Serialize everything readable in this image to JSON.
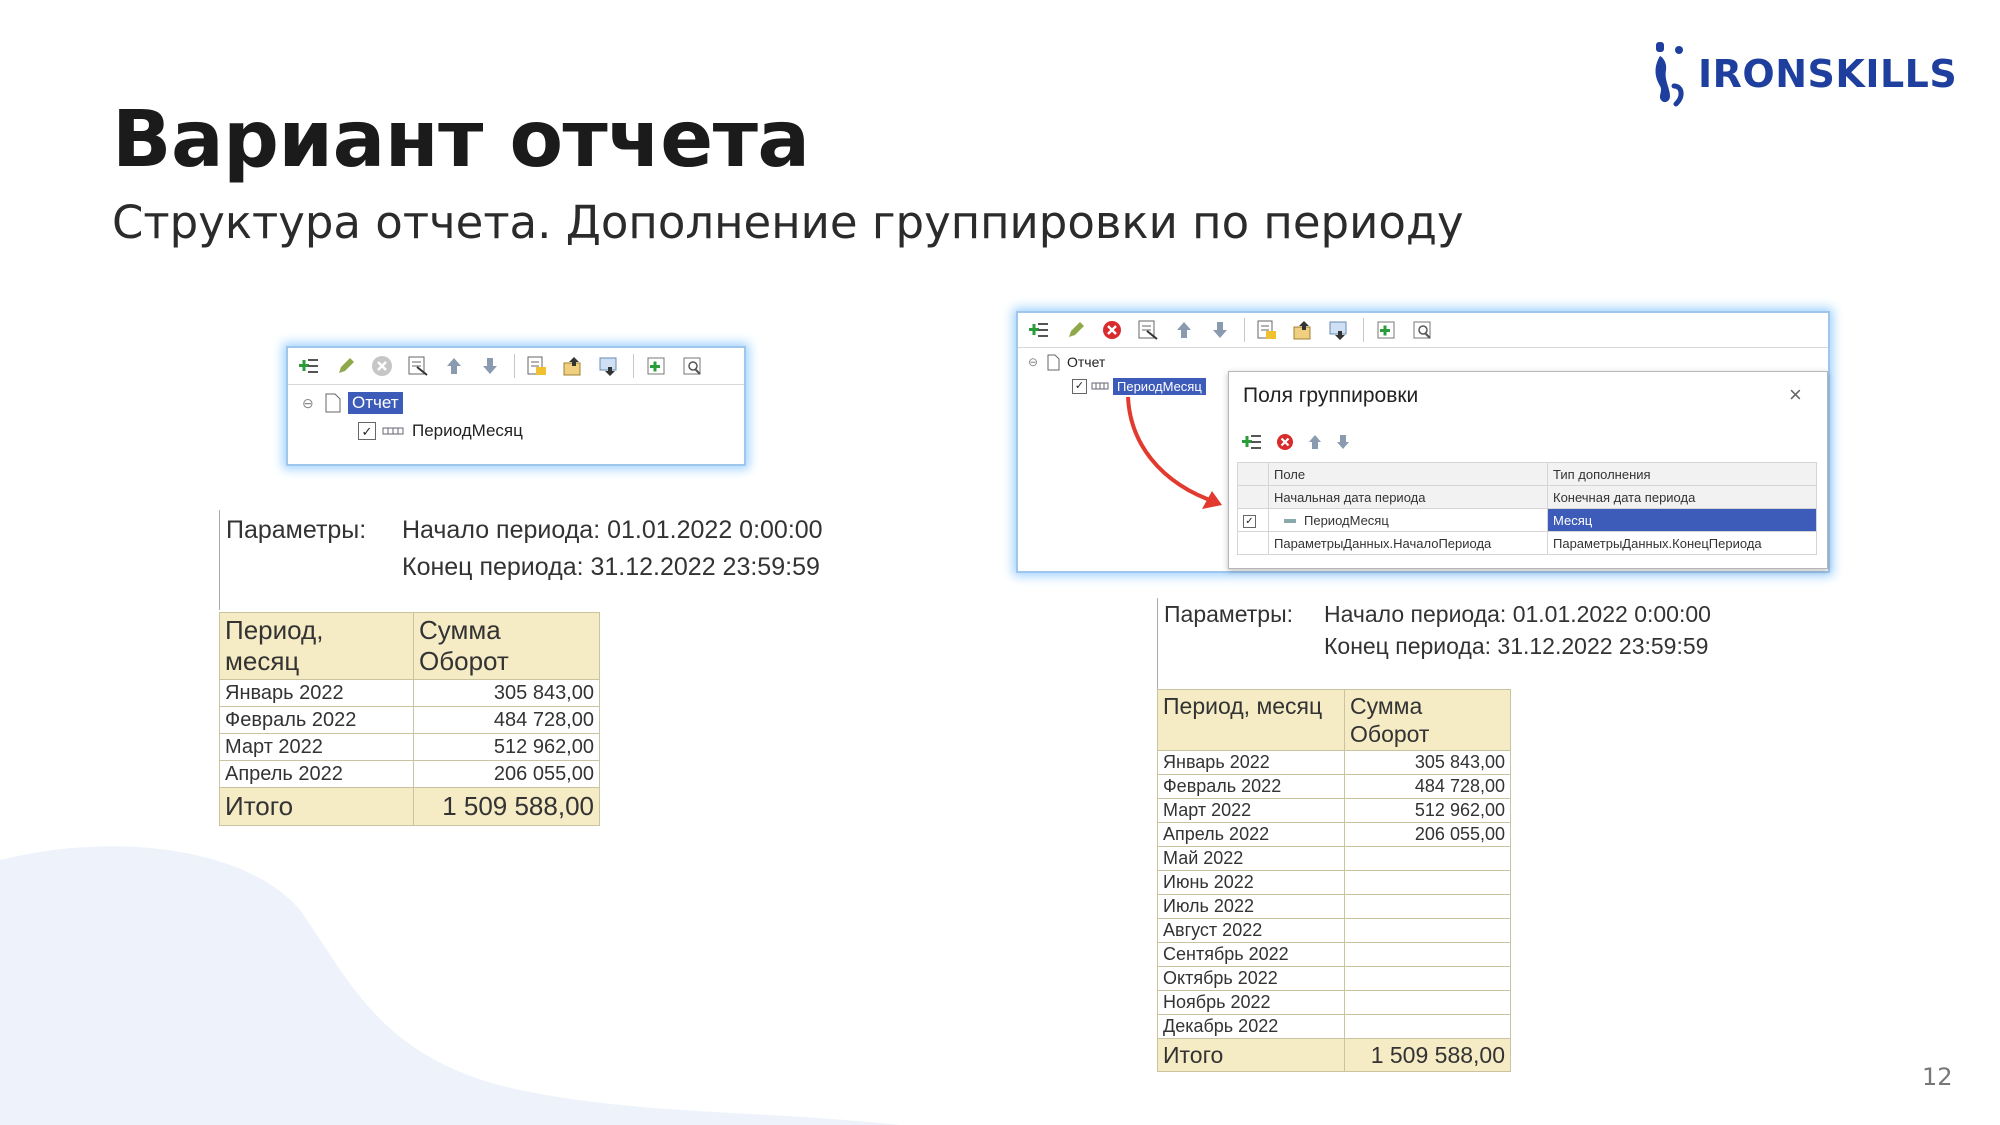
{
  "brand": {
    "logo_text": "IRONSKILLS"
  },
  "slide": {
    "title": "Вариант отчета",
    "subtitle": "Структура отчета. Дополнение группировки по периоду",
    "page_number": "12"
  },
  "left_structure": {
    "root": "Отчет",
    "child": "ПериодМесяц"
  },
  "left_report": {
    "params_label": "Параметры:",
    "param_start": "Начало периода: 01.01.2022 0:00:00",
    "param_end": "Конец периода: 31.12.2022 23:59:59",
    "col_period": [
      "Период,",
      "месяц"
    ],
    "col_sum": [
      "Сумма",
      "Оборот"
    ],
    "rows": [
      {
        "period": "Январь 2022",
        "sum": "305 843,00"
      },
      {
        "period": "Февраль 2022",
        "sum": "484 728,00"
      },
      {
        "period": "Март 2022",
        "sum": "512 962,00"
      },
      {
        "period": "Апрель 2022",
        "sum": "206 055,00"
      }
    ],
    "total_label": "Итого",
    "total_value": "1 509 588,00"
  },
  "right_structure": {
    "root": "Отчет",
    "child": "ПериодМесяц",
    "dialog": {
      "title": "Поля группировки",
      "col_field": "Поле",
      "col_type": "Тип дополнения",
      "rows": [
        {
          "field": "Начальная дата периода",
          "type": "Конечная дата периода"
        },
        {
          "field": "ПериодМесяц",
          "type": "Месяц"
        },
        {
          "field": "ПараметрыДанных.НачалоПериода",
          "type": "ПараметрыДанных.КонецПериода"
        }
      ]
    }
  },
  "right_report": {
    "params_label": "Параметры:",
    "param_start": "Начало периода: 01.01.2022 0:00:00",
    "param_end": "Конец периода: 31.12.2022 23:59:59",
    "col_period": "Период, месяц",
    "col_sum": [
      "Сумма",
      "Оборот"
    ],
    "rows": [
      {
        "period": "Январь 2022",
        "sum": "305 843,00"
      },
      {
        "period": "Февраль 2022",
        "sum": "484 728,00"
      },
      {
        "period": "Март 2022",
        "sum": "512 962,00"
      },
      {
        "period": "Апрель 2022",
        "sum": "206 055,00"
      },
      {
        "period": "Май 2022",
        "sum": ""
      },
      {
        "period": "Июнь 2022",
        "sum": ""
      },
      {
        "period": "Июль 2022",
        "sum": ""
      },
      {
        "period": "Август 2022",
        "sum": ""
      },
      {
        "period": "Сентябрь 2022",
        "sum": ""
      },
      {
        "period": "Октябрь 2022",
        "sum": ""
      },
      {
        "period": "Ноябрь 2022",
        "sum": ""
      },
      {
        "period": "Декабрь 2022",
        "sum": ""
      }
    ],
    "total_label": "Итого",
    "total_value": "1 509 588,00"
  },
  "icons": {
    "toolbar": [
      "add-icon",
      "edit-icon",
      "delete-icon",
      "settings-icon",
      "arrow-up-icon",
      "arrow-down-icon",
      "group-icon",
      "group-up-icon",
      "group-down-icon",
      "expand-icon",
      "collapse-icon"
    ],
    "close": "close-icon"
  },
  "colors": {
    "brand": "#1f3f9e",
    "highlight": "#f5ebc5",
    "selection": "#3d5bb8",
    "arrow": "#e23a2e",
    "panel_glow": "#9fd2ff"
  }
}
